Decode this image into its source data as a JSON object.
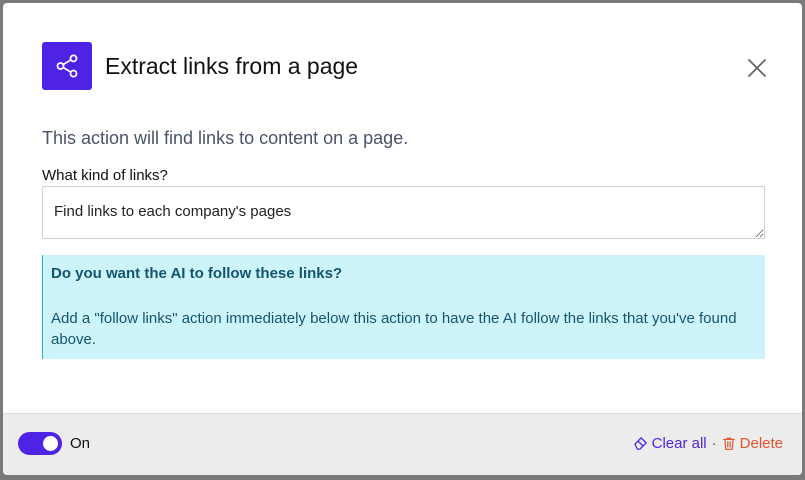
{
  "dialog": {
    "title": "Extract links from a page",
    "icon": "share-icon",
    "description": "This action will find links to content on a page.",
    "field_label": "What kind of links?",
    "field_value": "Find links to each company's pages",
    "info": {
      "heading": "Do you want the AI to follow these links?",
      "body": "Add a \"follow links\" action immediately below this action to have the AI follow the links that you've found above."
    }
  },
  "footer": {
    "toggle_label": "On",
    "toggle_state": true,
    "clear_label": "Clear all",
    "separator": "·",
    "delete_label": "Delete"
  },
  "colors": {
    "accent": "#4f23e6",
    "info_bg": "#cdf4fb",
    "info_border": "#1fb8d8",
    "info_text": "#14556e",
    "delete": "#e0552b"
  }
}
